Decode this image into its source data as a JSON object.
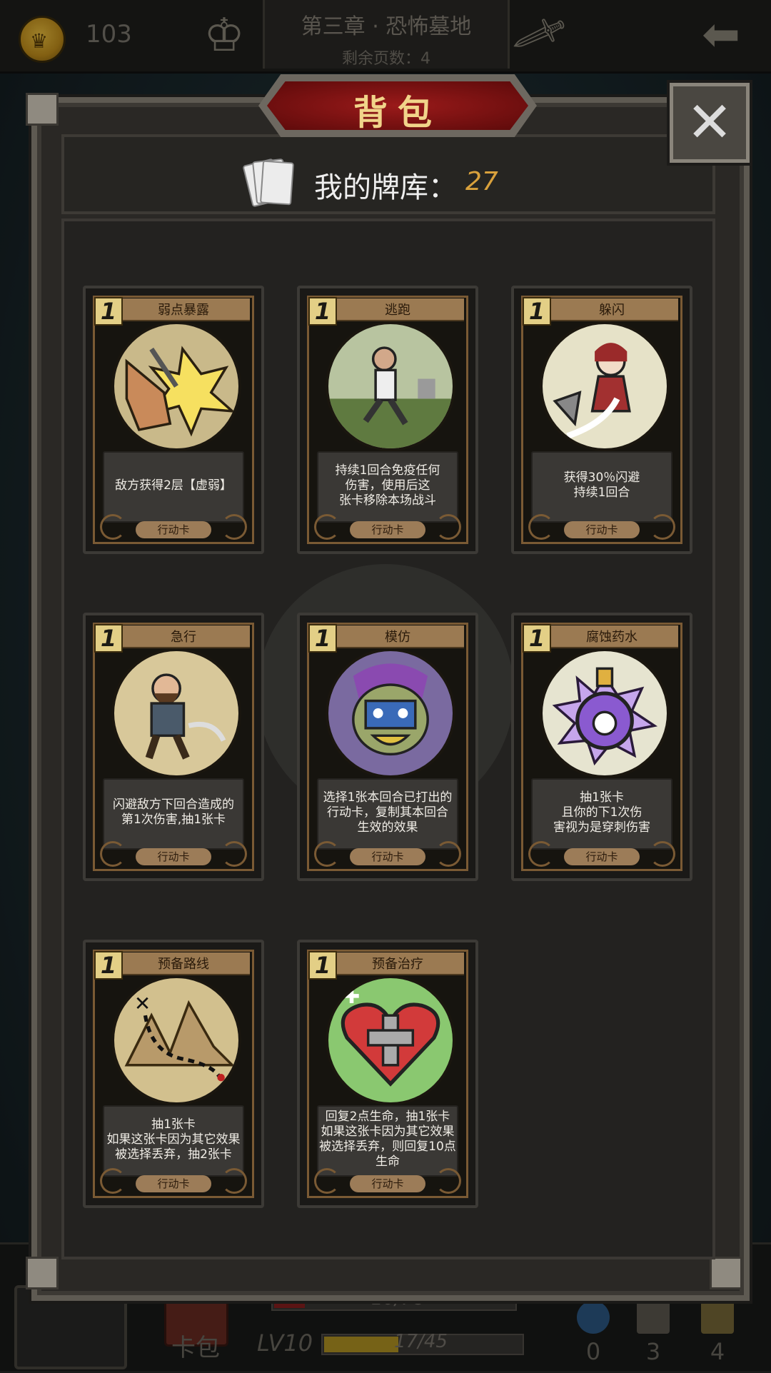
{
  "topbar": {
    "coins": "103",
    "chapter_title": "第三章 · 恐怖墓地",
    "pages_left": "剩余页数：4"
  },
  "panel": {
    "title": "背包",
    "close": "✕",
    "deck_label": "我的牌库：",
    "deck_count": "27"
  },
  "cards": [
    {
      "cost": "1",
      "name": "弱点暴露",
      "desc": "敌方获得2层【虚弱】",
      "type": "行动卡"
    },
    {
      "cost": "1",
      "name": "逃跑",
      "desc": "持续1回合免疫任何\n伤害，使用后这\n张卡移除本场战斗",
      "type": "行动卡"
    },
    {
      "cost": "1",
      "name": "躲闪",
      "desc": "获得30％闪避\n持续1回合",
      "type": "行动卡"
    },
    {
      "cost": "1",
      "name": "急行",
      "desc": "闪避敌方下回合造成的\n第1次伤害,抽1张卡",
      "type": "行动卡"
    },
    {
      "cost": "1",
      "name": "模仿",
      "desc": "选择1张本回合已打出的\n行动卡，复制其本回合\n生效的效果",
      "type": "行动卡"
    },
    {
      "cost": "1",
      "name": "腐蚀药水",
      "desc": "抽1张卡\n且你的下1次伤\n害视为是穿刺伤害",
      "type": "行动卡"
    },
    {
      "cost": "1",
      "name": "预备路线",
      "desc": "抽1张卡\n如果这张卡因为其它效果\n被选择丢弃，抽2张卡",
      "type": "行动卡"
    },
    {
      "cost": "1",
      "name": "预备治疗",
      "desc": "回复2点生命，抽1张卡\n如果这张卡因为其它效果\n被选择丢弃，则回复10点\n生命",
      "type": "行动卡"
    }
  ],
  "bottombar": {
    "cardpack_label": "卡包",
    "hp_text": "10/78",
    "hp_fraction": 0.128,
    "level": "LV10",
    "xp_text": "17/45",
    "xp_fraction": 0.378,
    "potions": "0",
    "hourglass": "3",
    "relics": "4"
  },
  "colors": {
    "accent_gold": "#d9a13c",
    "banner_red": "#8c1414",
    "hp_red": "#8c1f1f",
    "xp_yellow": "#b59724"
  }
}
